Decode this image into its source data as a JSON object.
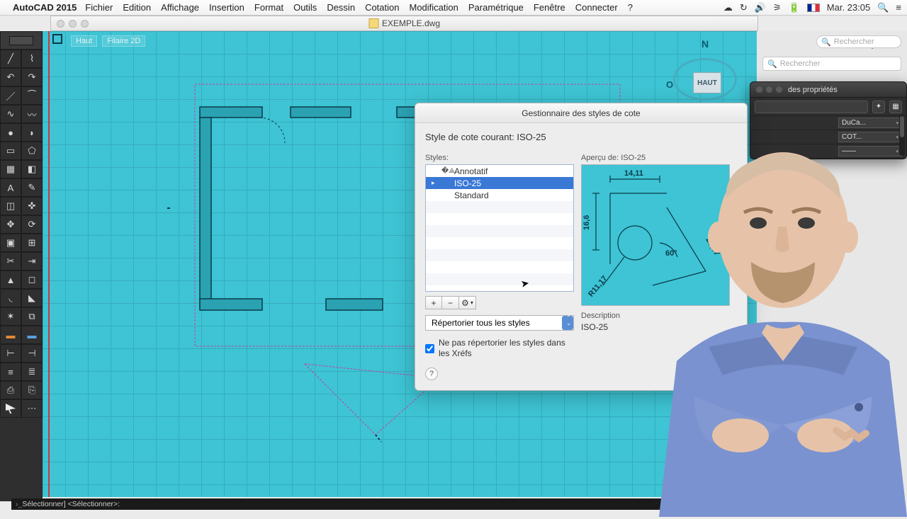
{
  "menubar": {
    "app": "AutoCAD 2015",
    "items": [
      "Fichier",
      "Edition",
      "Affichage",
      "Insertion",
      "Format",
      "Outils",
      "Dessin",
      "Cotation",
      "Modification",
      "Paramétrique",
      "Fenêtre",
      "Connecter",
      "?"
    ],
    "clock": "Mar. 23:05"
  },
  "titlebar": {
    "filename": "EXEMPLE.dwg"
  },
  "canvas": {
    "crumb1": "Haut",
    "crumb2": "Filaire 2D",
    "viewcube": {
      "n": "N",
      "o": "O",
      "face": "HAUT"
    }
  },
  "dialog": {
    "title": "Gestionnaire des styles de cote",
    "current_label": "Style de cote courant: ",
    "current_value": "ISO-25",
    "styles_label": "Styles:",
    "styles": [
      "Annotatif",
      "ISO-25",
      "Standard"
    ],
    "selected_index": 1,
    "list_select_label": "Répertorier tous les styles",
    "checkbox_label": "Ne pas répertorier les styles dans les Xréfs",
    "checkbox_checked": true,
    "preview_label_prefix": "Aperçu de: ",
    "preview_label_value": "ISO-25",
    "preview_dims": {
      "top": "14,11",
      "left": "16,6",
      "right": "28,07",
      "angle": "60°",
      "radius": "R11,17"
    },
    "description_label": "Description",
    "description_value": "ISO-25",
    "buttons": {
      "add": "+",
      "remove": "−",
      "gear": "⚙"
    },
    "help": "?"
  },
  "rpanel": {
    "search_placeholder": "Rechercher",
    "top_search_placeholder": "Rechercher"
  },
  "properties": {
    "title": "des propriétés",
    "rows": [
      {
        "k": "",
        "v": "DuCa..."
      },
      {
        "k": "",
        "v": "COT..."
      },
      {
        "k": "",
        "v": "——"
      }
    ]
  },
  "commandline": {
    "text": "Sélectionner] <Sélectionner>:"
  }
}
